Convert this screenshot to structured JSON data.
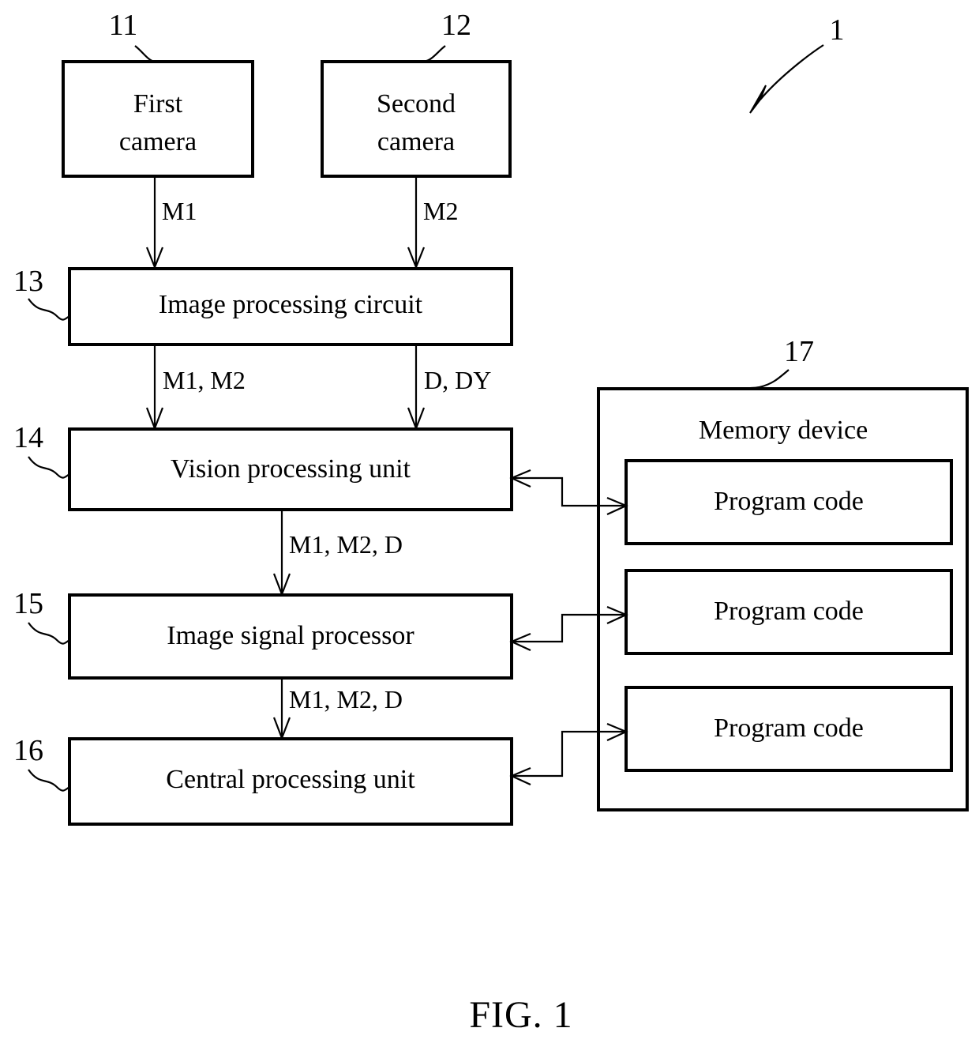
{
  "figure": {
    "caption": "FIG. 1",
    "system_ref": "1"
  },
  "blocks": [
    {
      "id": "first-camera",
      "ref": "11",
      "label_line1": "First",
      "label_line2": "camera"
    },
    {
      "id": "second-camera",
      "ref": "12",
      "label_line1": "Second",
      "label_line2": "camera"
    },
    {
      "id": "image-processing-circuit",
      "ref": "13",
      "label": "Image processing circuit"
    },
    {
      "id": "vision-processing-unit",
      "ref": "14",
      "label": "Vision processing unit"
    },
    {
      "id": "image-signal-processor",
      "ref": "15",
      "label": "Image signal processor"
    },
    {
      "id": "central-processing-unit",
      "ref": "16",
      "label": "Central processing unit"
    },
    {
      "id": "memory-device",
      "ref": "17",
      "label": "Memory device"
    }
  ],
  "memory": {
    "title": "Memory device",
    "ref": "17",
    "program_codes": [
      {
        "label": "Program code"
      },
      {
        "label": "Program code"
      },
      {
        "label": "Program code"
      }
    ]
  },
  "signals": [
    {
      "id": "m1",
      "label": "M1"
    },
    {
      "id": "m2",
      "label": "M2"
    },
    {
      "id": "m1m2",
      "label": "M1, M2"
    },
    {
      "id": "d-dy",
      "label": "D, DY"
    },
    {
      "id": "m1m2d-vpu-isp",
      "label": "M1, M2, D"
    },
    {
      "id": "m1m2d-isp-cpu",
      "label": "M1, M2, D"
    }
  ],
  "colors": {
    "stroke": "#000000",
    "fill": "#ffffff"
  }
}
